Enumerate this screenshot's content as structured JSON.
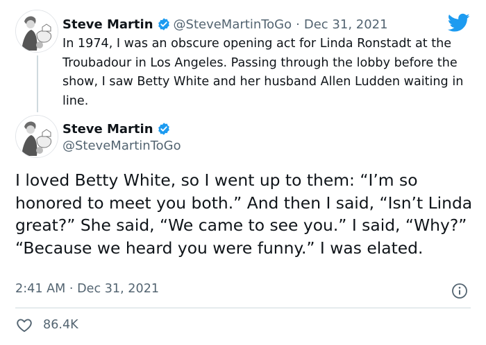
{
  "quoted_tweet": {
    "author_name": "Steve Martin",
    "handle": "@SteveMartinToGo",
    "separator": "·",
    "date": "Dec 31, 2021",
    "text": "In 1974, I was an obscure opening act for Linda Ronstadt at the Troubadour in Los Angeles.  Passing through the lobby before the show, I saw Betty White and her husband Allen Ludden waiting in line."
  },
  "main_tweet": {
    "author_name": "Steve Martin",
    "handle": "@SteveMartinToGo",
    "text": "I loved Betty White, so I went up to them: “I’m so honored to meet you both.” And then I said, “Isn’t Linda great?” She said, “We came to see you.” I said, “Why?” “Because we heard you were funny.” I was elated.",
    "timestamp": "2:41 AM · Dec 31, 2021",
    "likes": "86.4K"
  },
  "icons": {
    "verified": "verified-badge-icon",
    "logo": "twitter-bird-icon",
    "info": "info-icon",
    "like": "heart-icon"
  },
  "colors": {
    "verified": "#1d9bf0",
    "twitter_blue": "#1d9bf0",
    "secondary_text": "#536471",
    "primary_text": "#0f1419"
  }
}
